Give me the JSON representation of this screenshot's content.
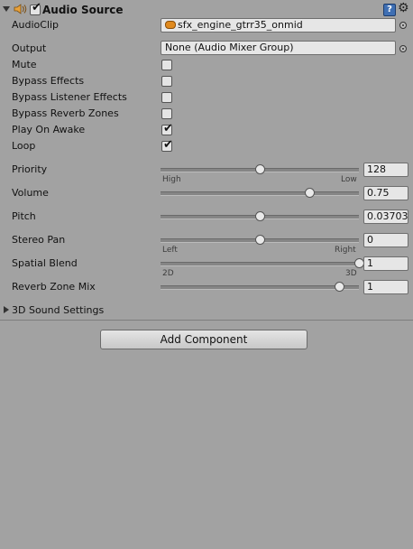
{
  "component": {
    "title": "Audio Source",
    "enabled": true,
    "help_symbol": "?",
    "icons": {
      "component": "speaker-icon",
      "help": "help-icon",
      "settings": "gear-icon"
    }
  },
  "fields": {
    "audioclip": {
      "label": "AudioClip",
      "value": "sfx_engine_gtrr35_onmid"
    },
    "output": {
      "label": "Output",
      "value": "None (Audio Mixer Group)"
    }
  },
  "toggles": [
    {
      "label": "Mute",
      "checked": false
    },
    {
      "label": "Bypass Effects",
      "checked": false
    },
    {
      "label": "Bypass Listener Effects",
      "checked": false
    },
    {
      "label": "Bypass Reverb Zones",
      "checked": false
    },
    {
      "label": "Play On Awake",
      "checked": true
    },
    {
      "label": "Loop",
      "checked": true
    }
  ],
  "sliders": [
    {
      "label": "Priority",
      "value": "128",
      "level": 0.5,
      "min_label": "High",
      "max_label": "Low"
    },
    {
      "label": "Volume",
      "value": "0.75",
      "level": 0.75
    },
    {
      "label": "Pitch",
      "value": "0.03703",
      "level": 0.5
    },
    {
      "label": "Stereo Pan",
      "value": "0",
      "level": 0.5,
      "min_label": "Left",
      "max_label": "Right"
    },
    {
      "label": "Spatial Blend",
      "value": "1",
      "level": 1.0,
      "min_label": "2D",
      "max_label": "3D"
    },
    {
      "label": "Reverb Zone Mix",
      "value": "1",
      "level": 0.9
    }
  ],
  "foldout": {
    "label": "3D Sound Settings",
    "expanded": false
  },
  "add_component": {
    "label": "Add Component"
  },
  "colors": {
    "background": "#a2a2a2",
    "clip_icon": "#e08a1e",
    "help_icon": "#3f6fb3"
  }
}
